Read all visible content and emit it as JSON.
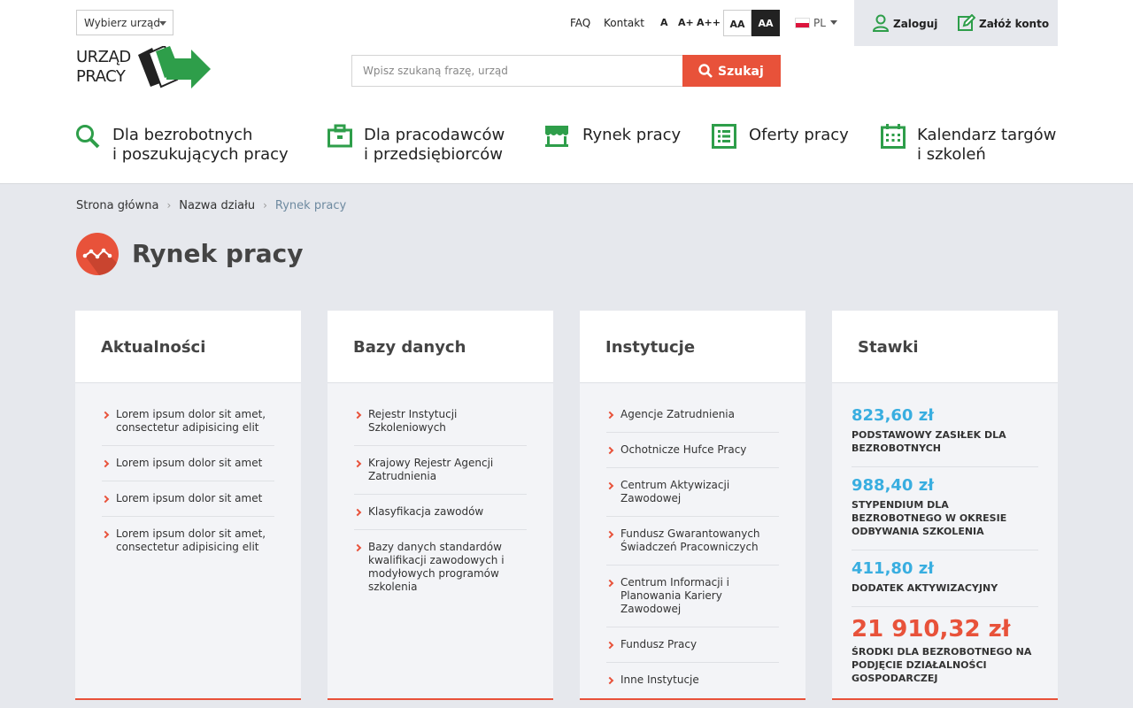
{
  "header": {
    "office_select": "Wybierz urząd",
    "logo_line1": "URZĄD",
    "logo_line2": "PRACY",
    "links": {
      "faq": "FAQ",
      "contact": "Kontakt"
    },
    "font_sizes": [
      "A",
      "A+",
      "A++"
    ],
    "contrast": [
      "AA",
      "AA"
    ],
    "language": "PL",
    "login": "Zaloguj",
    "register": "Załóż konto",
    "search_placeholder": "Wpisz szukaną frazę, urząd",
    "search_button": "Szukaj"
  },
  "main_nav": [
    {
      "line1": "Dla bezrobotnych",
      "line2": "i poszukujących pracy",
      "icon": "search-icon"
    },
    {
      "line1": "Dla pracodawców",
      "line2": "i przedsiębiorców",
      "icon": "briefcase-icon"
    },
    {
      "line1": "Rynek pracy",
      "line2": "",
      "icon": "market-stall-icon"
    },
    {
      "line1": "Oferty pracy",
      "line2": "",
      "icon": "list-icon"
    },
    {
      "line1": "Kalendarz targów",
      "line2": "i szkoleń",
      "icon": "calendar-icon"
    }
  ],
  "breadcrumb": [
    "Strona główna",
    "Nazwa działu",
    "Rynek pracy"
  ],
  "page_title": "Rynek pracy",
  "cards": {
    "news": {
      "title": "Aktualności",
      "items": [
        "Lorem ipsum dolor sit amet, consectetur adipisicing elit",
        "Lorem ipsum dolor sit amet",
        "Lorem ipsum dolor sit amet",
        "Lorem ipsum dolor sit amet, consectetur adipisicing elit"
      ]
    },
    "databases": {
      "title": "Bazy danych",
      "items": [
        "Rejestr Instytucji Szkoleniowych",
        "Krajowy Rejestr Agencji Zatrudnienia",
        "Klasyfikacja zawodów",
        "Bazy danych standardów kwalifikacji zawodowych i modyłowych programów szkolenia"
      ]
    },
    "institutions": {
      "title": "Instytucje",
      "items": [
        "Agencje Zatrudnienia",
        "Ochotnicze Hufce Pracy",
        "Centrum Aktywizacji Zawodowej",
        "Fundusz Gwarantowanych Świadczeń Pracowniczych",
        "Centrum Informacji i Planowania Kariery Zawodowej",
        "Fundusz Pracy",
        "Inne Instytucje"
      ]
    },
    "rates": {
      "title": "Stawki",
      "items": [
        {
          "value": "823,60 zł",
          "label": "PODSTAWOWY ZASIŁEK DLA BEZROBOTNYCH"
        },
        {
          "value": "988,40 zł",
          "label": "STYPENDIUM DLA BEZROBOTNEGO W OKRESIE ODBYWANIA SZKOLENIA"
        },
        {
          "value": "411,80 zł",
          "label": "DODATEK AKTYWIZACYJNY"
        },
        {
          "value": "21 910,32 zł",
          "label": "ŚRODKI DLA BEZROBOTNEGO NA PODJĘCIE DZIAŁALNOŚCI GOSPODARCZEJ"
        }
      ]
    }
  },
  "colors": {
    "accent": "#e8523a",
    "green": "#2e9e4a",
    "rate_blue": "#39aee0",
    "background": "#e6e8ed"
  }
}
